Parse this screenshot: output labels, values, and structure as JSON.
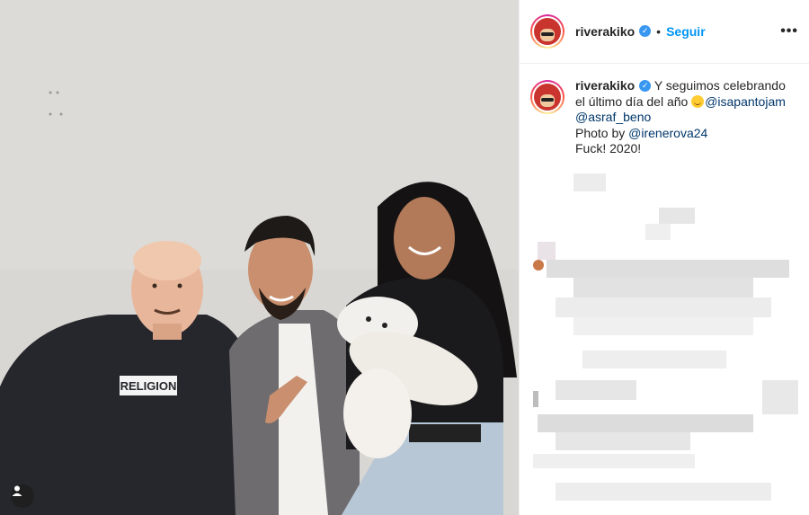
{
  "post": {
    "username": "riverakiko",
    "verified_mark": "✓",
    "separator": "•",
    "follow_label": "Seguir",
    "more_label": "•••"
  },
  "caption": {
    "username": "riverakiko",
    "text_1": "Y seguimos celebrando el último día del año ",
    "mention_1": "@isapantojam",
    "mention_2": "@asraf_beno",
    "photo_by": "Photo by ",
    "mention_3": "@irenerova24",
    "text_2": "Fuck! 2020!"
  },
  "photo": {
    "shirt_text": "RELIGION"
  },
  "icons": {
    "tag": "person-tag-icon",
    "emoji": "smiling-face-emoji"
  },
  "colors": {
    "accent": "#0095f6",
    "mention": "#00376b",
    "verified": "#3897f0"
  }
}
